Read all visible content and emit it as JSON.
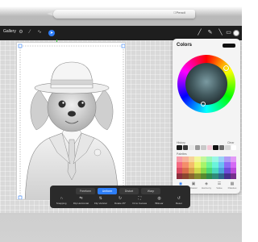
{
  "pencil": {
    "brand": "Pencil"
  },
  "topbar": {
    "gallery": "Gallery",
    "icons": [
      "wrench-icon",
      "magic-wand-icon",
      "selection-icon",
      "transform-arrow-icon"
    ],
    "right_icons": [
      "brush-icon",
      "smudge-icon",
      "eraser-icon",
      "layers-icon"
    ]
  },
  "colors_panel": {
    "title": "Colors",
    "current_color": "#111111",
    "history_label": "History",
    "history_clear": "Clear",
    "history_swatches": [
      "#1b1b1b",
      "#3a3a3a",
      "#e8e8e8",
      "#9a9a9a",
      "#c9c9c9",
      "#f4c9d6",
      "#111111",
      "#6b6b6b",
      "#d7d7d7",
      "#ffffff"
    ],
    "palette_label": "Palettes",
    "palette_colors": [
      "#f79aa8",
      "#f7b29a",
      "#f7d39a",
      "#f1f79a",
      "#c4f79a",
      "#9af7b5",
      "#9af7e6",
      "#9ad2f7",
      "#b09af7",
      "#e29af7",
      "#f46a81",
      "#f48d6a",
      "#f4bd6a",
      "#ebf46a",
      "#a7f46a",
      "#6af495",
      "#6af4db",
      "#6abff4",
      "#8d6af4",
      "#d46af4",
      "#d94b62",
      "#d96d4b",
      "#d9a14b",
      "#cfd94b",
      "#88d94b",
      "#4bd976",
      "#4bd9c0",
      "#4ba3d9",
      "#6e4bd9",
      "#b94bd9",
      "#8c2f3e",
      "#8c462f",
      "#8c672f",
      "#858c2f",
      "#578c2f",
      "#2f8c4c",
      "#2f8c7b",
      "#2f688c",
      "#462f8c",
      "#762f8c"
    ],
    "modes": [
      {
        "icon": "disc-icon",
        "label": "Disc"
      },
      {
        "icon": "classic-icon",
        "label": "Classic"
      },
      {
        "icon": "harmony-icon",
        "label": "Harmony"
      },
      {
        "icon": "value-icon",
        "label": "Value"
      },
      {
        "icon": "palettes-icon",
        "label": "Palettes"
      }
    ],
    "active_mode": 0
  },
  "transform": {
    "modes": [
      "Freeform",
      "Uniform",
      "Distort",
      "Warp"
    ],
    "active_mode": 1,
    "actions": [
      {
        "icon": "magnet-icon",
        "label": "Snapping"
      },
      {
        "icon": "flip-horizontal-icon",
        "label": "Flip Horizontal"
      },
      {
        "icon": "flip-vertical-icon",
        "label": "Flip Vertical"
      },
      {
        "icon": "rotate-icon",
        "label": "Rotate 45°"
      },
      {
        "icon": "fit-screen-icon",
        "label": "Fit to Canvas"
      },
      {
        "icon": "interpolation-icon",
        "label": "Bilinear"
      },
      {
        "icon": "reset-icon",
        "label": "Reset"
      }
    ]
  }
}
